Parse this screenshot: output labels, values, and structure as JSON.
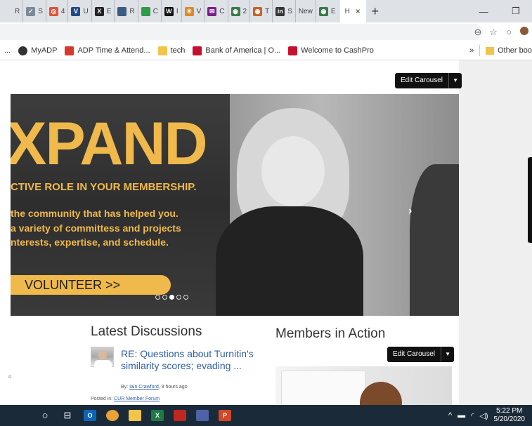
{
  "browser": {
    "tabs": [
      {
        "label": "R",
        "icon": "tab-favicon",
        "color": "#dee1e6"
      },
      {
        "label": "S",
        "icon": "tab-favicon",
        "color": "#7a8a99"
      },
      {
        "label": "4",
        "icon": "tab-favicon",
        "color": "#e0513a"
      },
      {
        "label": "U",
        "icon": "tab-favicon",
        "color": "#1f4a8a"
      },
      {
        "label": "E",
        "icon": "tab-favicon",
        "color": "#222222"
      },
      {
        "label": "R",
        "icon": "tab-favicon",
        "color": "#3b5d80"
      },
      {
        "label": "C",
        "icon": "tab-favicon",
        "color": "#2f9a48"
      },
      {
        "label": "I",
        "icon": "tab-favicon",
        "color": "#111111"
      },
      {
        "label": "V",
        "icon": "tab-favicon",
        "color": "#d98a2e"
      },
      {
        "label": "C",
        "icon": "tab-favicon",
        "color": "#7a1f8a"
      },
      {
        "label": "2",
        "icon": "tab-favicon",
        "color": "#3a7a4a"
      },
      {
        "label": "T",
        "icon": "tab-favicon",
        "color": "#c9612a"
      },
      {
        "label": "S",
        "icon": "tab-favicon",
        "color": "#333333"
      },
      {
        "label": "New",
        "icon": "none",
        "color": "#dee1e6"
      },
      {
        "label": "E",
        "icon": "tab-favicon",
        "color": "#3a7a4a"
      }
    ],
    "tab_glyphs": [
      "",
      "✓",
      "◎",
      "V",
      "X",
      "",
      "",
      "W",
      "✳",
      "✉",
      "◉",
      "◉",
      "in",
      "",
      "◉"
    ],
    "active_tab": {
      "label": "H",
      "close": "×"
    },
    "new_tab": "+",
    "window_controls": {
      "minimize": "—",
      "restore": "❐"
    }
  },
  "omnibar": {
    "icons": {
      "zoom": "⊖",
      "star": "☆",
      "record": "○"
    }
  },
  "bookmarks": [
    {
      "label": "...",
      "icon": "none",
      "color": "#ffffff"
    },
    {
      "label": "MyADP",
      "icon": "github-icon",
      "color": "#333333"
    },
    {
      "label": "ADP Time & Attend...",
      "icon": "adp-icon",
      "color": "#d63a2a"
    },
    {
      "label": "tech",
      "icon": "folder-icon",
      "color": "#f2c447"
    },
    {
      "label": "Bank of America | O...",
      "icon": "bofa-icon",
      "color": "#c8102e"
    },
    {
      "label": "Welcome to CashPro",
      "icon": "bofa-icon",
      "color": "#c8102e"
    }
  ],
  "bookmarks_more": "»",
  "bookmarks_other": "Other boo",
  "page": {
    "edit_carousel_top": "Edit Carousel",
    "edit_carousel_bottom": "Edit Carousel",
    "caret": "▼",
    "hero": {
      "big_word": "XPAND",
      "subtitle": "CTIVE ROLE IN YOUR MEMBERSHIP.",
      "lines": [
        "the community that has helped you.",
        "a variety of committess and projects",
        "nterests, expertise, and schedule."
      ],
      "cta": "VOLUNTEER >>",
      "dots": {
        "count": 5,
        "active_index": 2
      },
      "next": "›"
    },
    "latest": {
      "title": "Latest Discussions",
      "post_title": "RE: Questions about Turnitin's similarity scores; evading ...",
      "by": "By:",
      "author": "Iain Crawford",
      "time": ", 8 hours ago",
      "posted_in_label": "Posted in:",
      "forum": "CUR Member Forum"
    },
    "members": {
      "title": "Members in Action"
    },
    "stray_char": "o",
    "accent_color": "#f0b94b",
    "link_color": "#2f5fa8"
  },
  "taskbar": {
    "start": "○",
    "task_view": "⊟",
    "apps": [
      {
        "name": "outlook-icon",
        "label": "O",
        "color": "#0a64b8"
      },
      {
        "name": "chrome-icon",
        "label": "",
        "color": "#e8a23a"
      },
      {
        "name": "file-explorer-icon",
        "label": "",
        "color": "#f2c447"
      },
      {
        "name": "excel-icon",
        "label": "X",
        "color": "#1d7a45"
      },
      {
        "name": "acrobat-icon",
        "label": "",
        "color": "#c0271f"
      },
      {
        "name": "teams-icon",
        "label": "",
        "color": "#4e62a8"
      },
      {
        "name": "powerpoint-icon",
        "label": "P",
        "color": "#d24726"
      }
    ],
    "tray": {
      "chevron": "^",
      "time": "5:22 PM",
      "date": "5/20/2020"
    }
  }
}
